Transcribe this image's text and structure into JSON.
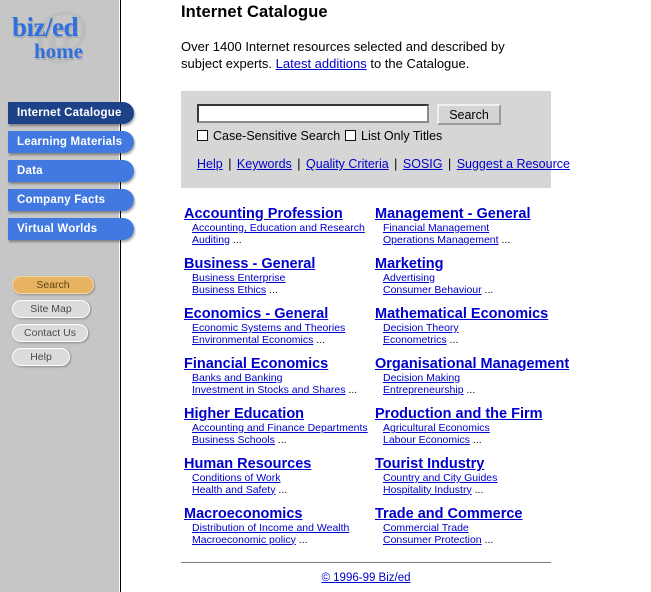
{
  "sidebar": {
    "logo": {
      "at_symbol": "@",
      "line1": "biz/ed",
      "line2": "home"
    },
    "nav_items": [
      {
        "label": "Internet Catalogue",
        "active": true
      },
      {
        "label": "Learning Materials",
        "active": false
      },
      {
        "label": "Data",
        "active": false
      },
      {
        "label": "Company Facts",
        "active": false
      },
      {
        "label": "Virtual Worlds",
        "active": false
      }
    ],
    "util_items": [
      {
        "label": "Search",
        "style": "orange"
      },
      {
        "label": "Site Map",
        "style": "grey"
      },
      {
        "label": "Contact Us",
        "style": "grey"
      },
      {
        "label": "Help",
        "style": "grey"
      }
    ]
  },
  "main": {
    "title": "Internet Catalogue",
    "intro_before": "Over 1400 Internet resources selected and described by subject experts. ",
    "intro_link": "Latest additions",
    "intro_after": " to the Catalogue."
  },
  "search": {
    "value": "",
    "placeholder": "",
    "button_label": "Search",
    "checkbox1_label": "Case-Sensitive Search",
    "checkbox2_label": "List Only Titles",
    "checkbox1_checked": false,
    "checkbox2_checked": false,
    "links": [
      "Help",
      "Keywords",
      "Quality Criteria",
      "SOSIG",
      "Suggest a Resource"
    ],
    "separator": "|"
  },
  "categories": {
    "left": [
      {
        "title": "Accounting Profession",
        "subs": [
          "Accounting, Education and Research",
          "Auditing"
        ]
      },
      {
        "title": "Business - General",
        "subs": [
          "Business Enterprise",
          "Business Ethics"
        ]
      },
      {
        "title": "Economics - General",
        "subs": [
          "Economic Systems and Theories",
          "Environmental Economics"
        ]
      },
      {
        "title": "Financial Economics",
        "subs": [
          "Banks and Banking",
          "Investment in Stocks and Shares"
        ]
      },
      {
        "title": "Higher Education",
        "subs": [
          "Accounting and Finance Departments",
          "Business Schools"
        ]
      },
      {
        "title": "Human Resources",
        "subs": [
          "Conditions of Work",
          "Health and Safety"
        ]
      },
      {
        "title": "Macroeconomics",
        "subs": [
          "Distribution of Income and Wealth",
          "Macroeconomic policy"
        ]
      }
    ],
    "right": [
      {
        "title": "Management - General",
        "subs": [
          "Financial Management",
          "Operations Management"
        ]
      },
      {
        "title": "Marketing",
        "subs": [
          "Advertising",
          "Consumer Behaviour"
        ]
      },
      {
        "title": "Mathematical Economics",
        "subs": [
          "Decision Theory",
          "Econometrics"
        ]
      },
      {
        "title": "Organisational Management",
        "subs": [
          "Decision Making",
          "Entrepreneurship"
        ]
      },
      {
        "title": "Production and the Firm",
        "subs": [
          "Agricultural Economics",
          "Labour Economics"
        ]
      },
      {
        "title": "Tourist Industry",
        "subs": [
          "Country and City Guides",
          "Hospitality Industry"
        ]
      },
      {
        "title": "Trade and Commerce",
        "subs": [
          "Commercial Trade",
          "Consumer Protection"
        ]
      }
    ],
    "ellipsis": "..."
  },
  "footer": {
    "copyright": "© 1996-99 Biz/ed"
  },
  "colors": {
    "sidebar_bg": "#c6c6c6",
    "nav_blue": "#4179e0",
    "nav_active": "#1e4288",
    "util_orange": "#e8b361",
    "link_blue": "#0000cc",
    "panel_bg": "#d6d6d6"
  }
}
